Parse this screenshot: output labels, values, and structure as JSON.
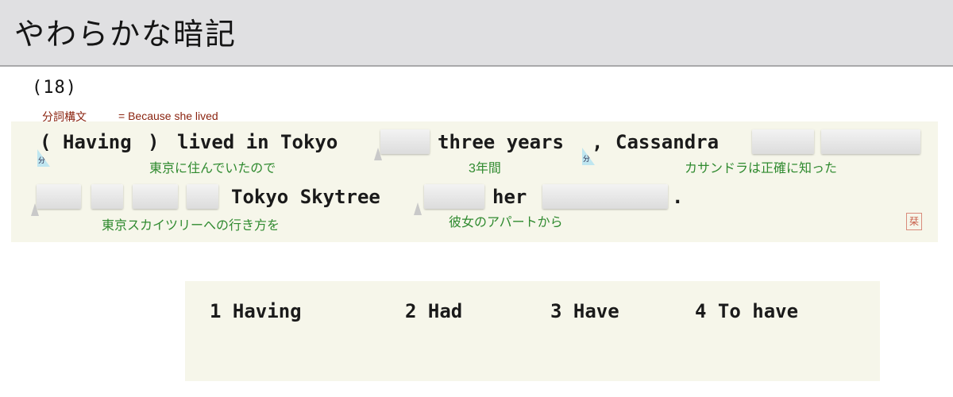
{
  "header": {
    "title": "やわらかな暗記"
  },
  "question": {
    "number": "(18)",
    "note_label": "分詞構文",
    "note_text": "= Because she lived",
    "line1": {
      "open_paren": "(",
      "having": "Having",
      "close_paren": ")",
      "lived_in_tokyo": "lived in Tokyo",
      "three_years": "three years",
      "comma": ",",
      "cassandra": "Cassandra"
    },
    "line2": {
      "tokyo_skytree": "Tokyo Skytree",
      "her": "her",
      "period": "."
    },
    "glosses": {
      "tokyo_lived": "東京に住んでいたので",
      "three_years": "3年間",
      "cassandra_knew": "カサンドラは正確に知った",
      "way_to_skytree": "東京スカイツリーへの行き方を",
      "from_apartment": "彼女のアパートから"
    },
    "marker_label": "分",
    "stamp": "栞"
  },
  "choices": [
    {
      "number": "1",
      "text": "Having"
    },
    {
      "number": "2",
      "text": "Had"
    },
    {
      "number": "3",
      "text": "Have"
    },
    {
      "number": "4",
      "text": "To have"
    }
  ]
}
